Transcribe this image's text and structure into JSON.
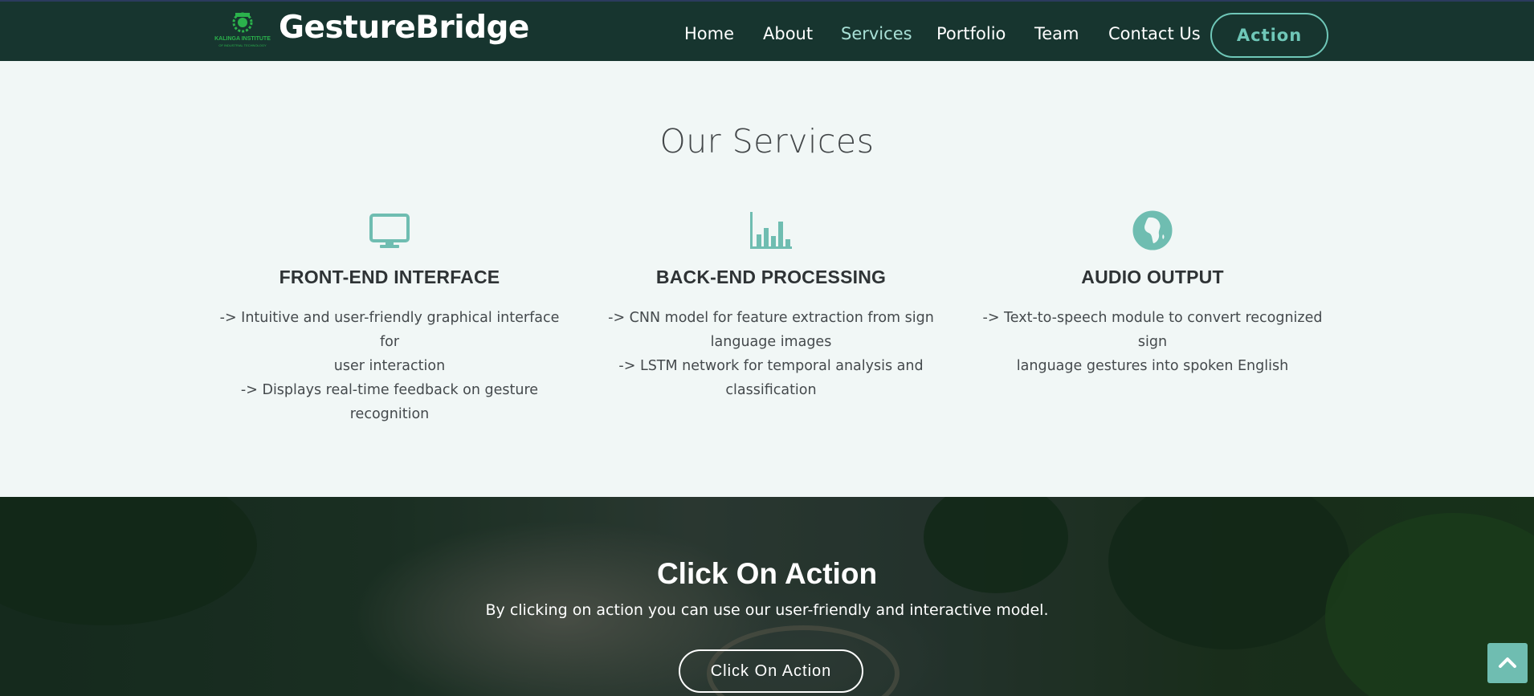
{
  "header": {
    "brand": "GestureBridge",
    "logo_text_line1": "KALINGA INSTITUTE",
    "logo_text_line2": "OF INDUSTRIAL TECHNOLOGY",
    "nav": [
      "Home",
      "About",
      "Services",
      "Portfolio",
      "Team",
      "Contact Us"
    ],
    "active_nav": "Services",
    "action_label": "Action"
  },
  "services": {
    "title": "Our Services",
    "items": [
      {
        "icon": "monitor-icon",
        "title": "FRONT-END INTERFACE",
        "lines": [
          "-> Intuitive and user-friendly graphical interface for",
          "user interaction",
          "-> Displays real-time feedback on gesture recognition"
        ]
      },
      {
        "icon": "bar-chart-icon",
        "title": "BACK-END PROCESSING",
        "lines": [
          "-> CNN model for feature extraction from sign",
          "language images",
          "-> LSTM network for temporal analysis and",
          "classification"
        ]
      },
      {
        "icon": "globe-icon",
        "title": "AUDIO OUTPUT",
        "lines": [
          "-> Text-to-speech module to convert recognized sign",
          "language gestures into spoken English"
        ]
      }
    ]
  },
  "cta": {
    "title": "Click On Action",
    "text": "By clicking on action you can use our user-friendly and interactive model.",
    "button_label": "Click On Action"
  },
  "colors": {
    "navbar_bg": "#17352f",
    "accent": "#6fc7b8",
    "icon": "#6fbdb1",
    "page_bg": "#f1f7f6"
  }
}
